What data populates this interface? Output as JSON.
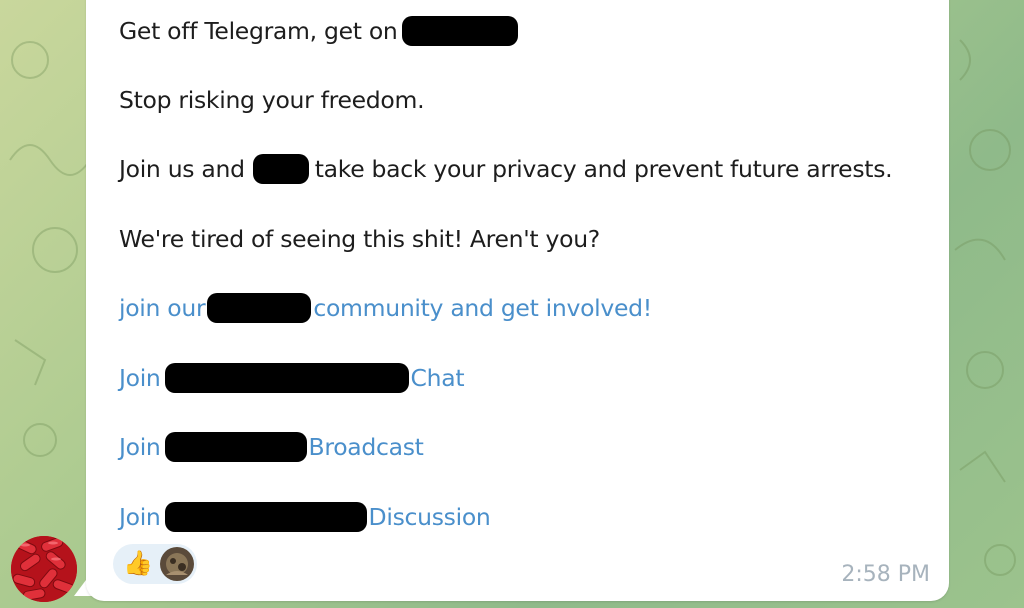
{
  "message": {
    "line1": {
      "text": "Get off Telegram, get on"
    },
    "line2": {
      "text": "Stop risking your freedom."
    },
    "line3": {
      "before": "Join us and",
      "after": "take back your privacy and prevent future arrests."
    },
    "line4": {
      "text": "We're tired of seeing this shit! Aren't you?"
    },
    "line5": {
      "before": "join our",
      "after": "community and get involved!"
    },
    "line6": {
      "before": "Join",
      "after": "Chat"
    },
    "line7": {
      "before": "Join",
      "after": "Broadcast"
    },
    "line8": {
      "before": "Join",
      "after": "Discussion"
    }
  },
  "reactions": {
    "emoji": "👍"
  },
  "meta": {
    "time": "2:58 PM"
  },
  "colors": {
    "link": "#4a8fcb",
    "text": "#1d1d1d",
    "time": "#a7b3bd",
    "bubble": "#ffffff"
  }
}
